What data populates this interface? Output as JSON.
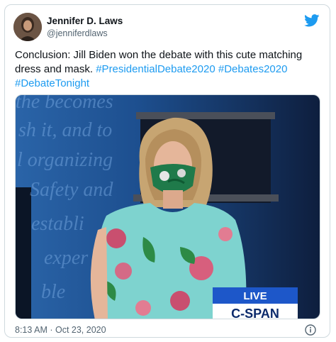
{
  "author": {
    "name": "Jennifer D. Laws",
    "handle": "@jenniferdlaws"
  },
  "tweet": {
    "text_plain": "Conclusion: Jill Biden won the debate with this cute matching dress and mask.",
    "hashtags": [
      "#PresidentialDebate2020",
      "#Debates2020",
      "#DebateTonight"
    ]
  },
  "media": {
    "backdrop_text": [
      "the becomes",
      "sh it, and to",
      "l organizing",
      "Safety and",
      "establi",
      "exper",
      "ble"
    ],
    "live_label": "LIVE",
    "network_label": "C-SPAN"
  },
  "footer": {
    "timestamp": "8:13 AM · Oct 23, 2020"
  },
  "colors": {
    "link": "#1d9bf0",
    "text": "#0f1419",
    "muted": "#536471",
    "border": "#cfd9de"
  },
  "icons": [
    "twitter-bird-icon",
    "info-icon"
  ]
}
